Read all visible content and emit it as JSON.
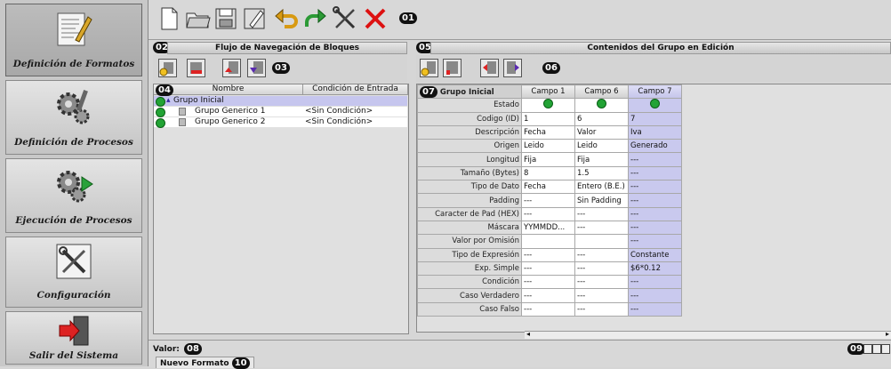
{
  "nav": {
    "items": [
      {
        "label": "Definición de Formatos"
      },
      {
        "label": "Definición de Procesos"
      },
      {
        "label": "Ejecución de Procesos"
      },
      {
        "label": "Configuración"
      },
      {
        "label": "Salir del Sistema"
      }
    ]
  },
  "badges": {
    "b01": "01",
    "b02": "02",
    "b03": "03",
    "b04": "04",
    "b05": "05",
    "b06": "06",
    "b07": "07",
    "b08": "08",
    "b09": "09",
    "b10": "10"
  },
  "flow_panel": {
    "title": "Flujo de Navegación de Bloques",
    "columns": [
      "Nombre",
      "Condición de Entrada"
    ],
    "rows": [
      {
        "name": "Grupo Inicial",
        "condition": ""
      },
      {
        "name": "Grupo Generico 1",
        "condition": "<Sin Condición>"
      },
      {
        "name": "Grupo Generico 2",
        "condition": "<Sin Condición>"
      }
    ]
  },
  "content_panel": {
    "title": "Contenidos del Grupo en Edición",
    "corner": "Grupo Inicial",
    "columns": [
      "Campo 1",
      "Campo 6",
      "Campo 7"
    ],
    "rows": [
      {
        "label": "Estado",
        "c1": "",
        "c2": "",
        "c3": ""
      },
      {
        "label": "Codigo (ID)",
        "c1": "1",
        "c2": "6",
        "c3": "7"
      },
      {
        "label": "Descripción",
        "c1": "Fecha",
        "c2": "Valor",
        "c3": "Iva"
      },
      {
        "label": "Origen",
        "c1": "Leido",
        "c2": "Leido",
        "c3": "Generado"
      },
      {
        "label": "Longitud",
        "c1": "Fija",
        "c2": "Fija",
        "c3": "---"
      },
      {
        "label": "Tamaño (Bytes)",
        "c1": "8",
        "c2": "1.5",
        "c3": "---"
      },
      {
        "label": "Tipo de Dato",
        "c1": "Fecha",
        "c2": "Entero (B.E.)",
        "c3": "---"
      },
      {
        "label": "Padding",
        "c1": "---",
        "c2": "Sin Padding",
        "c3": "---"
      },
      {
        "label": "Caracter de Pad (HEX)",
        "c1": "---",
        "c2": "---",
        "c3": "---"
      },
      {
        "label": "Máscara",
        "c1": "YYMMDD...",
        "c2": "---",
        "c3": "---"
      },
      {
        "label": "Valor por Omisión",
        "c1": "",
        "c2": "",
        "c3": "---"
      },
      {
        "label": "Tipo de Expresión",
        "c1": "---",
        "c2": "---",
        "c3": "Constante"
      },
      {
        "label": "Exp. Simple",
        "c1": "---",
        "c2": "---",
        "c3": "$6*0.12"
      },
      {
        "label": "Condición",
        "c1": "---",
        "c2": "---",
        "c3": "---"
      },
      {
        "label": "Caso Verdadero",
        "c1": "---",
        "c2": "---",
        "c3": "---"
      },
      {
        "label": "Caso Falso",
        "c1": "---",
        "c2": "---",
        "c3": "---"
      }
    ]
  },
  "status": {
    "valor_label": "Valor:",
    "format_label": "Nuevo Formato"
  },
  "colors": {
    "accent_col": "#c9c9ee",
    "ok_dot": "#22a335",
    "delete_red": "#d11"
  }
}
